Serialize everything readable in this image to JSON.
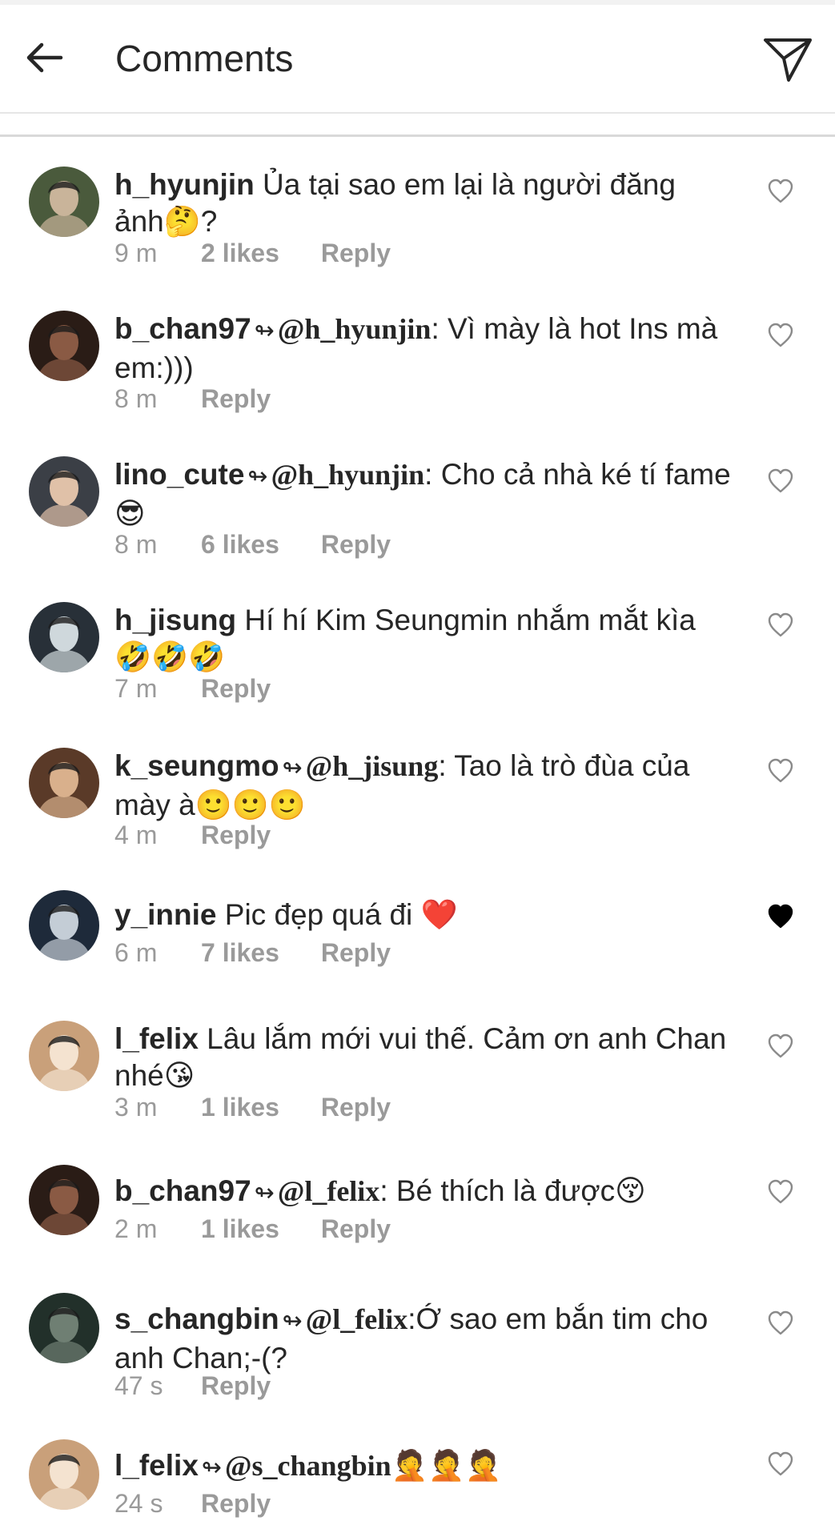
{
  "header": {
    "title": "Comments",
    "back_icon": "arrow-left-icon",
    "send_icon": "paper-plane-icon"
  },
  "comments": [
    {
      "username": "h_hyunjin",
      "mention": "",
      "text": " Ủa tại sao em lại là người đăng ảnh🤔?",
      "time": "9 m",
      "likes": "2 likes",
      "reply": "Reply",
      "liked": false
    },
    {
      "username": "b_chan97",
      "mention": "@h_hyunjin",
      "text": ": Vì mày là hot Ins mà em:)))",
      "time": "8 m",
      "likes": "",
      "reply": "Reply",
      "liked": false
    },
    {
      "username": "lino_cute",
      "mention": "@h_hyunjin",
      "text": ": Cho cả nhà ké tí fame😎",
      "time": "8 m",
      "likes": "6 likes",
      "reply": "Reply",
      "liked": false
    },
    {
      "username": "h_jisung",
      "mention": "",
      "text": " Hí hí Kim Seungmin nhắm mắt kìa 🤣🤣🤣",
      "time": "7 m",
      "likes": "",
      "reply": "Reply",
      "liked": false
    },
    {
      "username": "k_seungmo",
      "mention": "@h_jisung",
      "text": ": Tao là trò đùa của mày à🙂🙂🙂",
      "time": "4 m",
      "likes": "",
      "reply": "Reply",
      "liked": false
    },
    {
      "username": "y_innie",
      "mention": "",
      "text": " Pic đẹp quá đi ❤️",
      "time": "6 m",
      "likes": "7 likes",
      "reply": "Reply",
      "liked": true
    },
    {
      "username": "l_felix",
      "mention": "",
      "text": " Lâu lắm mới vui thế. Cảm ơn anh Chan nhé😘",
      "time": "3 m",
      "likes": "1 likes",
      "reply": "Reply",
      "liked": false
    },
    {
      "username": "b_chan97",
      "mention": "@l_felix",
      "text": ": Bé thích là được😚",
      "time": "2 m",
      "likes": "1 likes",
      "reply": "Reply",
      "liked": false
    },
    {
      "username": "s_changbin",
      "mention": "@l_felix",
      "text": ":Ớ sao em bắn tim cho anh Chan;-(?",
      "time": "47 s",
      "likes": "",
      "reply": "Reply",
      "liked": false
    },
    {
      "username": "l_felix",
      "mention": "@s_changbin",
      "text": "🤦🤦🤦",
      "time": "24 s",
      "likes": "",
      "reply": "Reply",
      "liked": false
    }
  ],
  "colors": {
    "text": "#262626",
    "meta": "#9a9a9a",
    "divider": "#d9d9d9",
    "liked_heart": "#000000"
  },
  "icons": {
    "reply_marker": "reply-arrow-icon",
    "heart": "heart-icon"
  }
}
